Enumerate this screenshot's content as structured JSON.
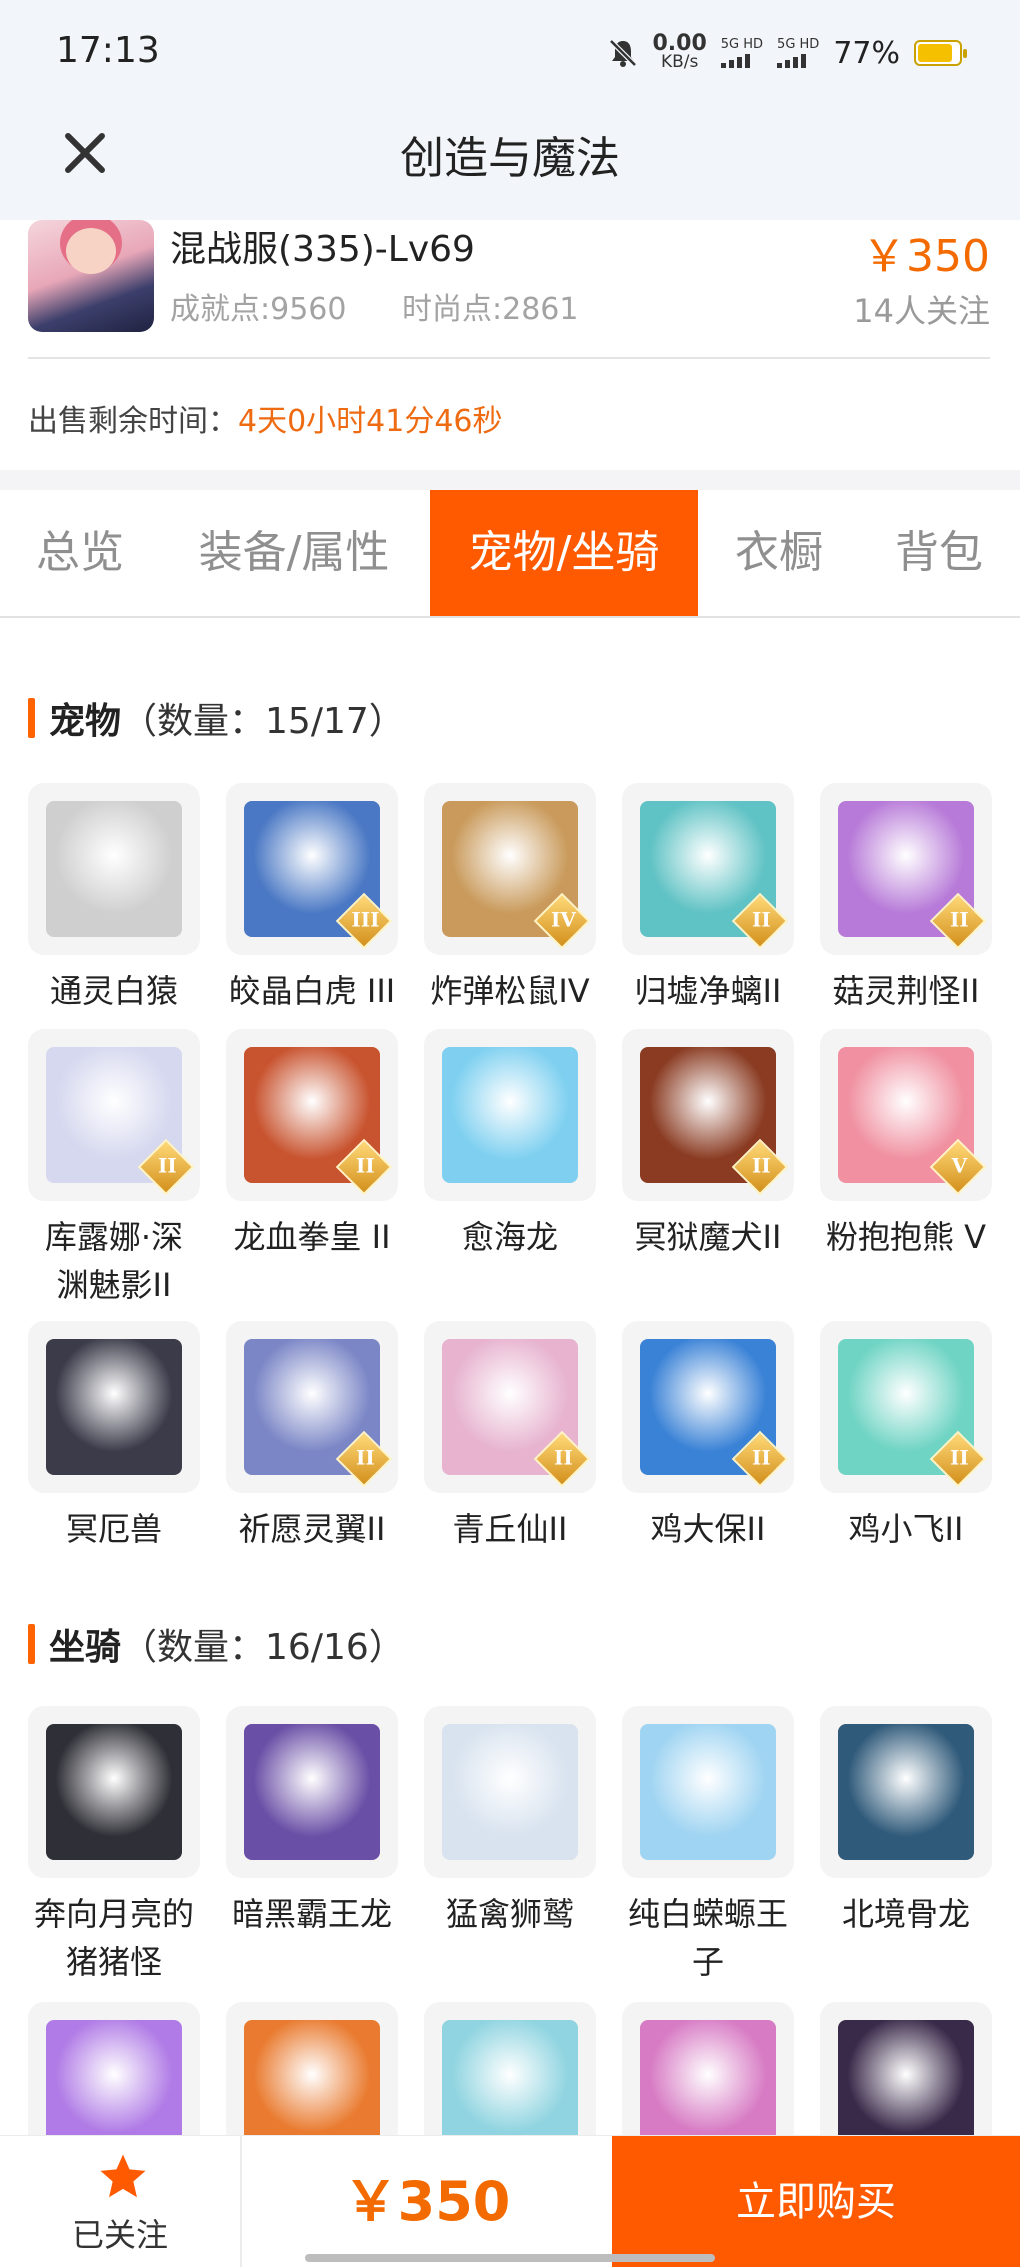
{
  "status_bar": {
    "time": "17:13",
    "net_speed_value": "0.00",
    "net_speed_unit": "KB/s",
    "sim1": "5G HD",
    "sim2": "5G HD",
    "battery": "77%",
    "icons": [
      "bell-off-icon",
      "signal-icon",
      "battery-icon"
    ]
  },
  "header": {
    "title": "创造与魔法",
    "close_icon": "close-icon"
  },
  "character": {
    "name": "混战服(335)-Lv69",
    "achievement": "成就点:9560",
    "fashion": "时尚点:2861",
    "price": "￥350",
    "followers": "14人关注",
    "remaining_label": "出售剩余时间：",
    "remaining_value": "4天0小时41分46秒"
  },
  "tabs": [
    {
      "label": "总览",
      "active": false
    },
    {
      "label": "装备/属性",
      "active": false
    },
    {
      "label": "宠物/坐骑",
      "active": true
    },
    {
      "label": "衣橱",
      "active": false
    },
    {
      "label": "背包",
      "active": false
    }
  ],
  "pets": {
    "title": "宠物",
    "count": "（数量：15/17）",
    "items": [
      {
        "name": "通灵白猿",
        "badge": "",
        "color": "#cfcfcf"
      },
      {
        "name": "皎晶白虎 III",
        "badge": "III",
        "color": "#4a78c4"
      },
      {
        "name": "炸弹松鼠IV",
        "badge": "IV",
        "color": "#c99a5b"
      },
      {
        "name": "归墟净螭II",
        "badge": "II",
        "color": "#5fc2c4"
      },
      {
        "name": "菇灵荆怪II",
        "badge": "II",
        "color": "#b77ad8"
      },
      {
        "name": "库露娜·深渊魅影II",
        "badge": "II",
        "color": "#d5d8ef"
      },
      {
        "name": "龙血拳皇 II",
        "badge": "II",
        "color": "#c8532f"
      },
      {
        "name": "愈海龙",
        "badge": "",
        "color": "#7fd0f0"
      },
      {
        "name": "冥狱魔犬II",
        "badge": "II",
        "color": "#8a3b22"
      },
      {
        "name": "粉抱抱熊 V",
        "badge": "V",
        "color": "#f090a0"
      },
      {
        "name": "冥厄兽",
        "badge": "",
        "color": "#3b3b4a"
      },
      {
        "name": "祈愿灵翼II",
        "badge": "II",
        "color": "#7b86c6"
      },
      {
        "name": "青丘仙II",
        "badge": "II",
        "color": "#e7b3cf"
      },
      {
        "name": "鸡大保II",
        "badge": "II",
        "color": "#3a82d6"
      },
      {
        "name": "鸡小飞II",
        "badge": "II",
        "color": "#6fd4c4"
      }
    ]
  },
  "mounts": {
    "title": "坐骑",
    "count": "（数量：16/16）",
    "items": [
      {
        "name": "奔向月亮的猪猪怪",
        "badge": "",
        "color": "#2f2f37"
      },
      {
        "name": "暗黑霸王龙",
        "badge": "",
        "color": "#6a4fa6"
      },
      {
        "name": "猛禽狮鹫",
        "badge": "",
        "color": "#d8e3ef"
      },
      {
        "name": "纯白蝾螈王子",
        "badge": "",
        "color": "#9fd4f2"
      },
      {
        "name": "北境骨龙",
        "badge": "",
        "color": "#2f5a7a"
      },
      {
        "name": "",
        "badge": "",
        "color": "#b07be6"
      },
      {
        "name": "",
        "badge": "",
        "color": "#e97a2f"
      },
      {
        "name": "",
        "badge": "",
        "color": "#8fd4e0"
      },
      {
        "name": "",
        "badge": "",
        "color": "#d77bc4"
      },
      {
        "name": "",
        "badge": "",
        "color": "#3a2a4a"
      }
    ]
  },
  "bottom": {
    "follow_label": "已关注",
    "price": "￥350",
    "buy_label": "立即购买"
  },
  "colors": {
    "accent": "#ff5a00",
    "price": "#f36a00"
  }
}
